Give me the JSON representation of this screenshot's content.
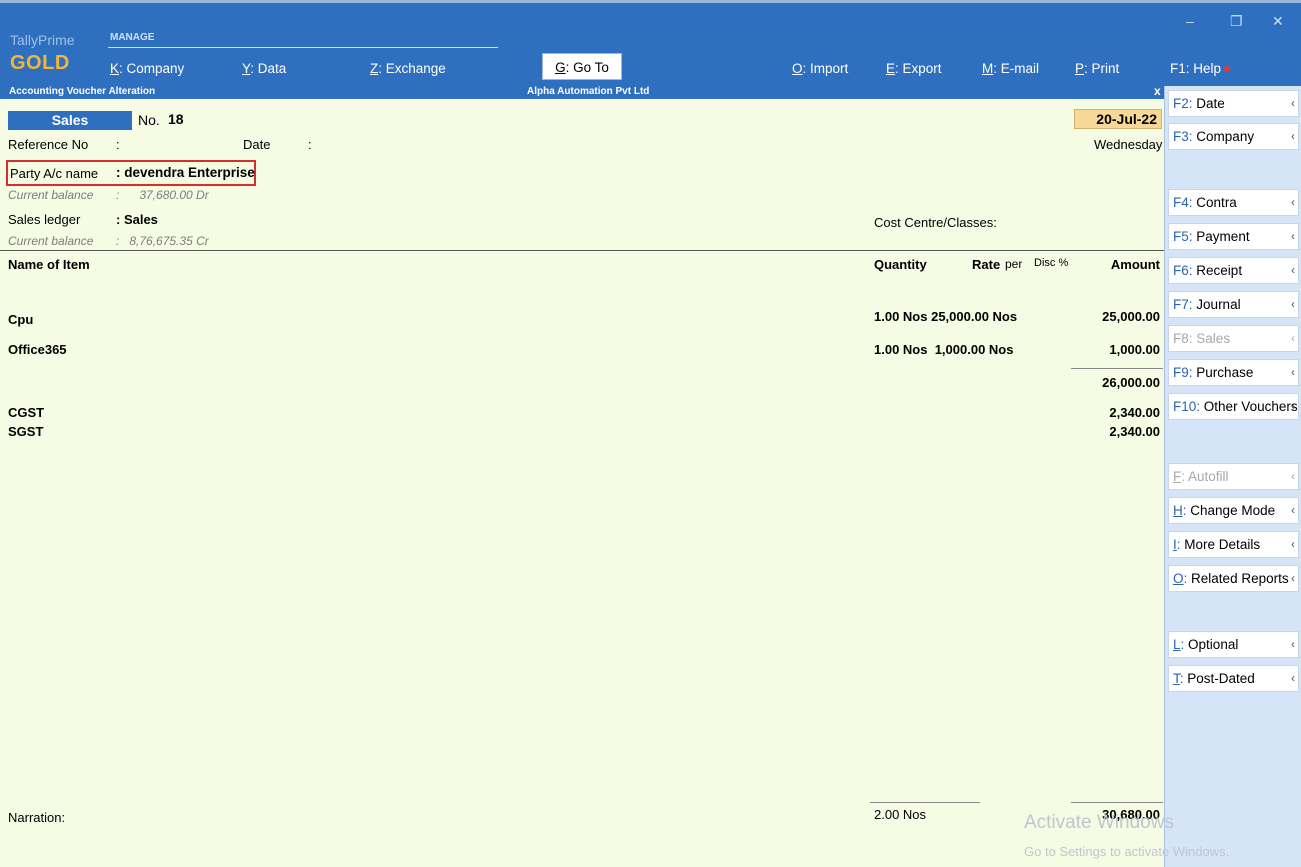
{
  "app": {
    "brand_line1": "TallyPrime",
    "brand_line2": "GOLD",
    "manage_label": "MANAGE"
  },
  "menu": {
    "company": {
      "key": "K",
      "label": ": Company"
    },
    "data": {
      "key": "Y",
      "label": ": Data"
    },
    "exchange": {
      "key": "Z",
      "label": ": Exchange"
    },
    "goto": {
      "key": "G",
      "label": ": Go To"
    },
    "import": {
      "key": "O",
      "label": ": Import"
    },
    "export": {
      "key": "E",
      "label": ": Export"
    },
    "email": {
      "key": "M",
      "label": ": E-mail"
    },
    "print": {
      "key": "P",
      "label": ": Print"
    },
    "help": {
      "key": "F1",
      "label": ": Help"
    }
  },
  "window_controls": {
    "minimize": "–",
    "restore": "❐",
    "close": "✕"
  },
  "titlebar": {
    "left": "Accounting Voucher Alteration",
    "center": "Alpha Automation Pvt Ltd",
    "close": "x"
  },
  "voucher": {
    "type": "Sales",
    "no_label": "No.",
    "no_value": "18",
    "reference_label": "Reference No",
    "reference_colon": ":",
    "date_label": "Date",
    "date_colon": ":",
    "date_value": "20-Jul-22",
    "weekday": "Wednesday",
    "party_label": "Party A/c name",
    "party_value": ": devendra Enterprise",
    "party_balance_label": "Current balance",
    "party_balance_value": ":      37,680.00 Dr",
    "sales_ledger_label": "Sales ledger",
    "sales_ledger_value": ": Sales",
    "sales_balance_label": "Current balance",
    "sales_balance_value": ":   8,76,675.35 Cr",
    "cost_centre_label": "Cost Centre/Classes:"
  },
  "table": {
    "headers": {
      "name": "Name of Item",
      "quantity": "Quantity",
      "rate": "Rate",
      "per": "per",
      "disc": "Disc %",
      "amount": "Amount"
    },
    "rows": [
      {
        "name": "Cpu",
        "qty_rate": "1.00 Nos 25,000.00 Nos",
        "amount": "25,000.00"
      },
      {
        "name": "Office365",
        "qty_rate": "1.00 Nos  1,000.00 Nos",
        "amount": "1,000.00"
      }
    ],
    "subtotal": "26,000.00",
    "taxes": [
      {
        "name": "CGST",
        "amount": "2,340.00"
      },
      {
        "name": "SGST",
        "amount": "2,340.00"
      }
    ],
    "narration_label": "Narration:",
    "total_qty": "2.00 Nos",
    "total_amount": "30,680.00"
  },
  "sidebar": {
    "buttons": [
      {
        "key": "F2",
        "label": "Date",
        "dim": false
      },
      {
        "key": "F3",
        "label": "Company",
        "dim": false
      },
      {
        "key": "F4",
        "label": "Contra",
        "dim": false
      },
      {
        "key": "F5",
        "label": "Payment",
        "dim": false
      },
      {
        "key": "F6",
        "label": "Receipt",
        "dim": false
      },
      {
        "key": "F7",
        "label": "Journal",
        "dim": false
      },
      {
        "key": "F8",
        "label": "Sales",
        "dim": true
      },
      {
        "key": "F9",
        "label": "Purchase",
        "dim": false
      },
      {
        "key": "F10",
        "label": "Other Vouchers",
        "dim": false
      },
      {
        "key": "F",
        "label": "Autofill",
        "dim": true
      },
      {
        "key": "H",
        "label": "Change Mode",
        "dim": false
      },
      {
        "key": "I",
        "label": "More Details",
        "dim": false
      },
      {
        "key": "O",
        "label": "Related Reports",
        "dim": false
      },
      {
        "key": "L",
        "label": "Optional",
        "dim": false
      },
      {
        "key": "T",
        "label": "Post-Dated",
        "dim": false
      }
    ],
    "chevron": "‹",
    "separator": ":"
  },
  "watermark": {
    "line1": "Activate Windows",
    "line2": "Go to Settings to activate Windows."
  },
  "colors": {
    "header_blue": "#2f6fbf",
    "background": "#f6fce4",
    "sidebar": "#d5e4f6",
    "brand_gold": "#f2b53a",
    "highlight_red": "#d32f2f",
    "date_highlight": "#f6d898"
  }
}
